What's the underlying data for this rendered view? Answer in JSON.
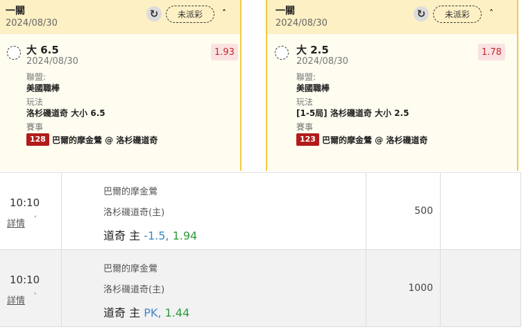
{
  "slips": [
    {
      "header_title": "一關",
      "header_date": "2024/08/30",
      "status": "未派彩",
      "selection": "大 6.5",
      "selection_date": "2024/08/30",
      "odds": "1.93",
      "league_label": "聯盟:",
      "league": "美國職棒",
      "market_label": "玩法",
      "market": "洛杉磯道奇 大小 6.5",
      "event_label": "賽事",
      "match_no": "128",
      "match": "巴爾的摩金鶯 @ 洛杉磯道奇"
    },
    {
      "header_title": "一關",
      "header_date": "2024/08/30",
      "status": "未派彩",
      "selection": "大 2.5",
      "selection_date": "2024/08/30",
      "odds": "1.78",
      "league_label": "聯盟:",
      "league": "美國職棒",
      "market_label": "玩法",
      "market": "[1-5局] 洛杉磯道奇 大小 2.5",
      "event_label": "賽事",
      "match_no": "123",
      "match": "巴爾的摩金鶯 @ 洛杉磯道奇"
    }
  ],
  "rows": [
    {
      "time": "10:10",
      "detail": "詳情",
      "team_away": "巴爾的摩金鶯",
      "team_home": "洛杉磯道奇(主)",
      "bet_team": "道奇 主",
      "handicap": "-1.5,",
      "odds": "1.94",
      "stake": "500"
    },
    {
      "time": "10:10",
      "detail": "詳情",
      "team_away": "巴爾的摩金鶯",
      "team_home": "洛杉磯道奇(主)",
      "bet_team": "道奇 主",
      "handicap": "PK,",
      "odds": "1.44",
      "stake": "1000"
    }
  ],
  "colors": {
    "accent_yellow": "#f5c842",
    "header_bg": "#fdf0c4",
    "odds_red": "#c0282d",
    "match_red": "#b31b1b",
    "handicap_blue": "#3b86c9",
    "odds_green": "#2b9b3a"
  },
  "icons": {
    "refresh": "refresh-icon",
    "collapse": "chevron-up-icon",
    "detail": "chevron-down-icon",
    "select": "radio-icon"
  }
}
